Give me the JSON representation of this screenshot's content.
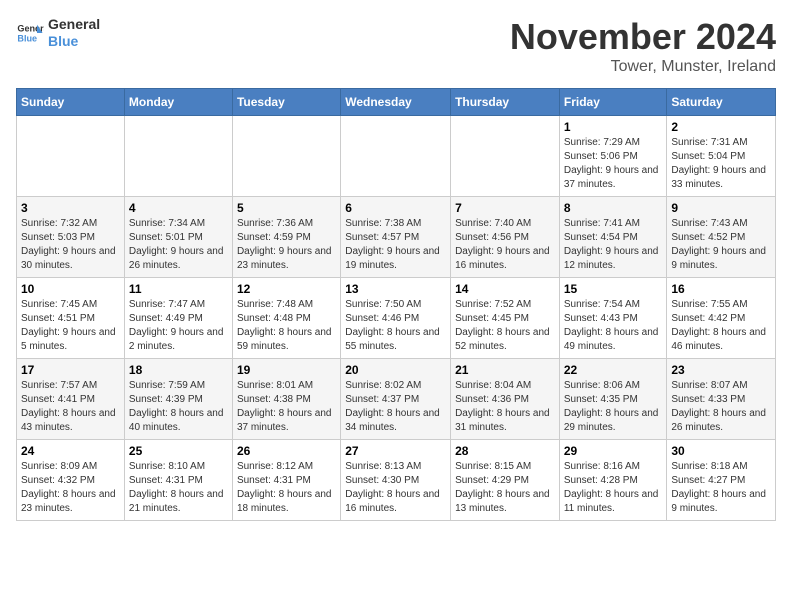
{
  "logo": {
    "text_general": "General",
    "text_blue": "Blue"
  },
  "title": "November 2024",
  "subtitle": "Tower, Munster, Ireland",
  "days_of_week": [
    "Sunday",
    "Monday",
    "Tuesday",
    "Wednesday",
    "Thursday",
    "Friday",
    "Saturday"
  ],
  "weeks": [
    [
      {
        "day": "",
        "info": ""
      },
      {
        "day": "",
        "info": ""
      },
      {
        "day": "",
        "info": ""
      },
      {
        "day": "",
        "info": ""
      },
      {
        "day": "",
        "info": ""
      },
      {
        "day": "1",
        "info": "Sunrise: 7:29 AM\nSunset: 5:06 PM\nDaylight: 9 hours and 37 minutes."
      },
      {
        "day": "2",
        "info": "Sunrise: 7:31 AM\nSunset: 5:04 PM\nDaylight: 9 hours and 33 minutes."
      }
    ],
    [
      {
        "day": "3",
        "info": "Sunrise: 7:32 AM\nSunset: 5:03 PM\nDaylight: 9 hours and 30 minutes."
      },
      {
        "day": "4",
        "info": "Sunrise: 7:34 AM\nSunset: 5:01 PM\nDaylight: 9 hours and 26 minutes."
      },
      {
        "day": "5",
        "info": "Sunrise: 7:36 AM\nSunset: 4:59 PM\nDaylight: 9 hours and 23 minutes."
      },
      {
        "day": "6",
        "info": "Sunrise: 7:38 AM\nSunset: 4:57 PM\nDaylight: 9 hours and 19 minutes."
      },
      {
        "day": "7",
        "info": "Sunrise: 7:40 AM\nSunset: 4:56 PM\nDaylight: 9 hours and 16 minutes."
      },
      {
        "day": "8",
        "info": "Sunrise: 7:41 AM\nSunset: 4:54 PM\nDaylight: 9 hours and 12 minutes."
      },
      {
        "day": "9",
        "info": "Sunrise: 7:43 AM\nSunset: 4:52 PM\nDaylight: 9 hours and 9 minutes."
      }
    ],
    [
      {
        "day": "10",
        "info": "Sunrise: 7:45 AM\nSunset: 4:51 PM\nDaylight: 9 hours and 5 minutes."
      },
      {
        "day": "11",
        "info": "Sunrise: 7:47 AM\nSunset: 4:49 PM\nDaylight: 9 hours and 2 minutes."
      },
      {
        "day": "12",
        "info": "Sunrise: 7:48 AM\nSunset: 4:48 PM\nDaylight: 8 hours and 59 minutes."
      },
      {
        "day": "13",
        "info": "Sunrise: 7:50 AM\nSunset: 4:46 PM\nDaylight: 8 hours and 55 minutes."
      },
      {
        "day": "14",
        "info": "Sunrise: 7:52 AM\nSunset: 4:45 PM\nDaylight: 8 hours and 52 minutes."
      },
      {
        "day": "15",
        "info": "Sunrise: 7:54 AM\nSunset: 4:43 PM\nDaylight: 8 hours and 49 minutes."
      },
      {
        "day": "16",
        "info": "Sunrise: 7:55 AM\nSunset: 4:42 PM\nDaylight: 8 hours and 46 minutes."
      }
    ],
    [
      {
        "day": "17",
        "info": "Sunrise: 7:57 AM\nSunset: 4:41 PM\nDaylight: 8 hours and 43 minutes."
      },
      {
        "day": "18",
        "info": "Sunrise: 7:59 AM\nSunset: 4:39 PM\nDaylight: 8 hours and 40 minutes."
      },
      {
        "day": "19",
        "info": "Sunrise: 8:01 AM\nSunset: 4:38 PM\nDaylight: 8 hours and 37 minutes."
      },
      {
        "day": "20",
        "info": "Sunrise: 8:02 AM\nSunset: 4:37 PM\nDaylight: 8 hours and 34 minutes."
      },
      {
        "day": "21",
        "info": "Sunrise: 8:04 AM\nSunset: 4:36 PM\nDaylight: 8 hours and 31 minutes."
      },
      {
        "day": "22",
        "info": "Sunrise: 8:06 AM\nSunset: 4:35 PM\nDaylight: 8 hours and 29 minutes."
      },
      {
        "day": "23",
        "info": "Sunrise: 8:07 AM\nSunset: 4:33 PM\nDaylight: 8 hours and 26 minutes."
      }
    ],
    [
      {
        "day": "24",
        "info": "Sunrise: 8:09 AM\nSunset: 4:32 PM\nDaylight: 8 hours and 23 minutes."
      },
      {
        "day": "25",
        "info": "Sunrise: 8:10 AM\nSunset: 4:31 PM\nDaylight: 8 hours and 21 minutes."
      },
      {
        "day": "26",
        "info": "Sunrise: 8:12 AM\nSunset: 4:31 PM\nDaylight: 8 hours and 18 minutes."
      },
      {
        "day": "27",
        "info": "Sunrise: 8:13 AM\nSunset: 4:30 PM\nDaylight: 8 hours and 16 minutes."
      },
      {
        "day": "28",
        "info": "Sunrise: 8:15 AM\nSunset: 4:29 PM\nDaylight: 8 hours and 13 minutes."
      },
      {
        "day": "29",
        "info": "Sunrise: 8:16 AM\nSunset: 4:28 PM\nDaylight: 8 hours and 11 minutes."
      },
      {
        "day": "30",
        "info": "Sunrise: 8:18 AM\nSunset: 4:27 PM\nDaylight: 8 hours and 9 minutes."
      }
    ]
  ]
}
